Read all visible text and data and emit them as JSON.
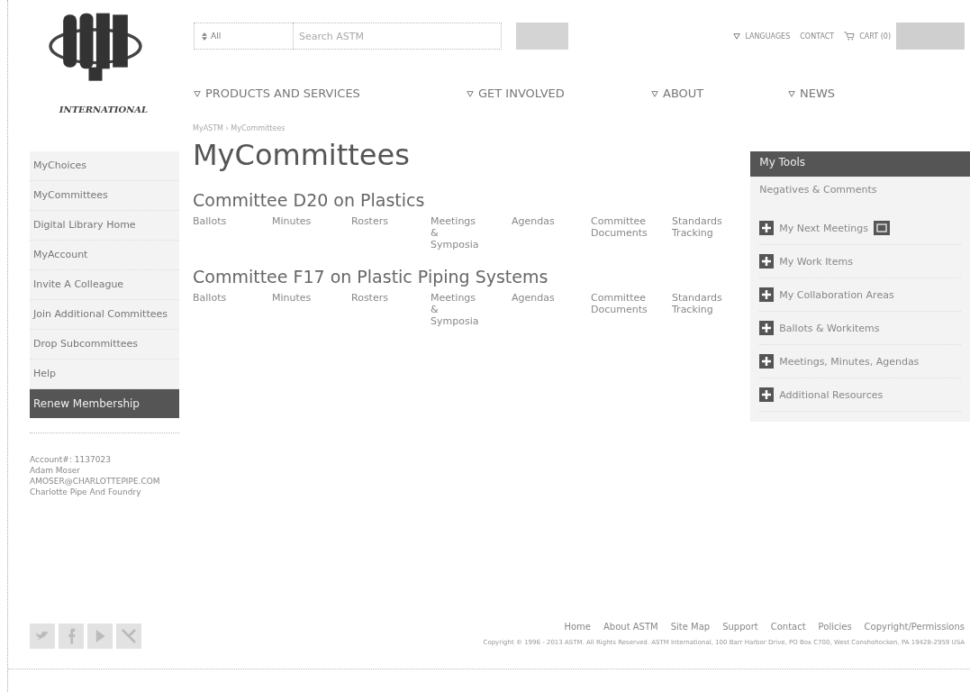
{
  "logo_text": "INTERNATIONAL",
  "header": {
    "scope": "All",
    "search_placeholder": "Search ASTM",
    "utility_links": [
      {
        "label": "LANGUAGES",
        "kind": "menu"
      },
      {
        "label": "CONTACT",
        "kind": "link"
      },
      {
        "label": "CART (0)",
        "kind": "cart"
      }
    ],
    "nav": [
      "PRODUCTS AND SERVICES",
      "GET INVOLVED",
      "ABOUT",
      "NEWS"
    ]
  },
  "breadcrumb": "MyASTM › MyCommittees",
  "sidebar": {
    "items": [
      {
        "label": "MyChoices",
        "kind": "link"
      },
      {
        "label": "MyCommittees",
        "kind": "link"
      },
      {
        "label": "Digital Library Home",
        "kind": "link"
      },
      {
        "label": "MyAccount",
        "kind": "link"
      },
      {
        "label": "Invite A Colleague",
        "kind": "link"
      },
      {
        "label": "Join Additional Committees",
        "kind": "link"
      },
      {
        "label": "Drop Subcommittees",
        "kind": "link"
      },
      {
        "label": "Help",
        "kind": "link"
      },
      {
        "label": "Renew Membership",
        "kind": "action"
      }
    ],
    "account": [
      "Account#: 1137023",
      "Adam Moser",
      "AMOSER@CHARLOTTEPIPE.COM",
      "Charlotte Pipe And Foundry"
    ]
  },
  "title": "MyCommittees",
  "committees": [
    {
      "name": "Committee D20 on Plastics",
      "links": [
        "Ballots",
        "Minutes",
        "Rosters",
        "Meetings & Symposia",
        "Agendas",
        "Committee Documents",
        "Standards Tracking"
      ]
    },
    {
      "name": "Committee F17 on Plastic Piping Systems",
      "links": [
        "Ballots",
        "Minutes",
        "Rosters",
        "Meetings & Symposia",
        "Agendas",
        "Committee Documents",
        "Standards Tracking"
      ]
    }
  ],
  "tools": {
    "title": "My Tools",
    "top_link": "Negatives & Comments",
    "items": [
      {
        "label": "My Next Meetings",
        "badge": true
      },
      {
        "label": "My Work Items",
        "badge": false
      },
      {
        "label": "My Collaboration Areas",
        "badge": false
      },
      {
        "label": "Ballots & Workitems",
        "badge": false
      },
      {
        "label": "Meetings, Minutes, Agendas",
        "badge": false
      },
      {
        "label": "Additional Resources",
        "badge": false
      }
    ]
  },
  "footer": {
    "links": [
      "Home",
      "About ASTM",
      "Site Map",
      "Support",
      "Contact",
      "Policies",
      "Copyright/Permissions"
    ],
    "copyright": "Copyright © 1996 - 2013 ASTM. All Rights Reserved. ASTM International, 100 Barr Harbor Drive, PO Box C700, West Conshohocken, PA 19428-2959 USA"
  }
}
